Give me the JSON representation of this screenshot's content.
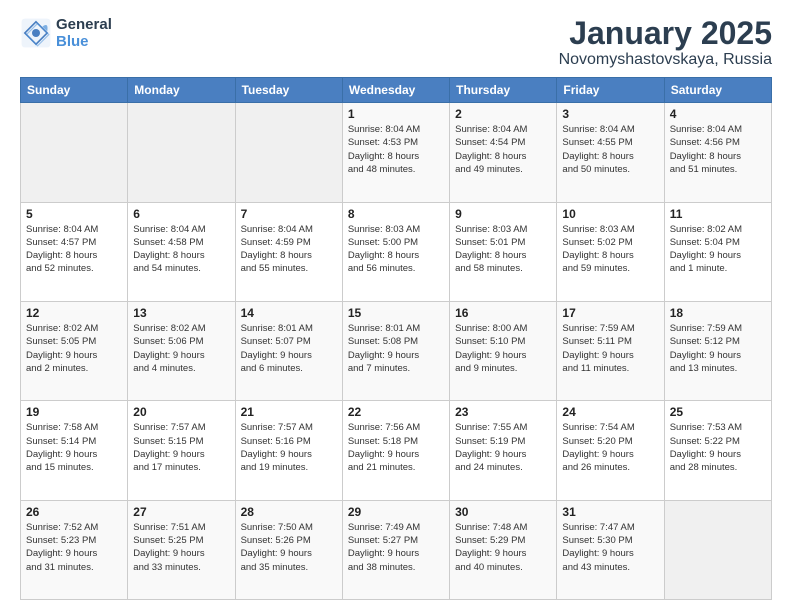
{
  "logo": {
    "line1": "General",
    "line2": "Blue"
  },
  "title": "January 2025",
  "subtitle": "Novomyshastovskaya, Russia",
  "weekdays": [
    "Sunday",
    "Monday",
    "Tuesday",
    "Wednesday",
    "Thursday",
    "Friday",
    "Saturday"
  ],
  "weeks": [
    [
      {
        "day": "",
        "info": ""
      },
      {
        "day": "",
        "info": ""
      },
      {
        "day": "",
        "info": ""
      },
      {
        "day": "1",
        "info": "Sunrise: 8:04 AM\nSunset: 4:53 PM\nDaylight: 8 hours\nand 48 minutes."
      },
      {
        "day": "2",
        "info": "Sunrise: 8:04 AM\nSunset: 4:54 PM\nDaylight: 8 hours\nand 49 minutes."
      },
      {
        "day": "3",
        "info": "Sunrise: 8:04 AM\nSunset: 4:55 PM\nDaylight: 8 hours\nand 50 minutes."
      },
      {
        "day": "4",
        "info": "Sunrise: 8:04 AM\nSunset: 4:56 PM\nDaylight: 8 hours\nand 51 minutes."
      }
    ],
    [
      {
        "day": "5",
        "info": "Sunrise: 8:04 AM\nSunset: 4:57 PM\nDaylight: 8 hours\nand 52 minutes."
      },
      {
        "day": "6",
        "info": "Sunrise: 8:04 AM\nSunset: 4:58 PM\nDaylight: 8 hours\nand 54 minutes."
      },
      {
        "day": "7",
        "info": "Sunrise: 8:04 AM\nSunset: 4:59 PM\nDaylight: 8 hours\nand 55 minutes."
      },
      {
        "day": "8",
        "info": "Sunrise: 8:03 AM\nSunset: 5:00 PM\nDaylight: 8 hours\nand 56 minutes."
      },
      {
        "day": "9",
        "info": "Sunrise: 8:03 AM\nSunset: 5:01 PM\nDaylight: 8 hours\nand 58 minutes."
      },
      {
        "day": "10",
        "info": "Sunrise: 8:03 AM\nSunset: 5:02 PM\nDaylight: 8 hours\nand 59 minutes."
      },
      {
        "day": "11",
        "info": "Sunrise: 8:02 AM\nSunset: 5:04 PM\nDaylight: 9 hours\nand 1 minute."
      }
    ],
    [
      {
        "day": "12",
        "info": "Sunrise: 8:02 AM\nSunset: 5:05 PM\nDaylight: 9 hours\nand 2 minutes."
      },
      {
        "day": "13",
        "info": "Sunrise: 8:02 AM\nSunset: 5:06 PM\nDaylight: 9 hours\nand 4 minutes."
      },
      {
        "day": "14",
        "info": "Sunrise: 8:01 AM\nSunset: 5:07 PM\nDaylight: 9 hours\nand 6 minutes."
      },
      {
        "day": "15",
        "info": "Sunrise: 8:01 AM\nSunset: 5:08 PM\nDaylight: 9 hours\nand 7 minutes."
      },
      {
        "day": "16",
        "info": "Sunrise: 8:00 AM\nSunset: 5:10 PM\nDaylight: 9 hours\nand 9 minutes."
      },
      {
        "day": "17",
        "info": "Sunrise: 7:59 AM\nSunset: 5:11 PM\nDaylight: 9 hours\nand 11 minutes."
      },
      {
        "day": "18",
        "info": "Sunrise: 7:59 AM\nSunset: 5:12 PM\nDaylight: 9 hours\nand 13 minutes."
      }
    ],
    [
      {
        "day": "19",
        "info": "Sunrise: 7:58 AM\nSunset: 5:14 PM\nDaylight: 9 hours\nand 15 minutes."
      },
      {
        "day": "20",
        "info": "Sunrise: 7:57 AM\nSunset: 5:15 PM\nDaylight: 9 hours\nand 17 minutes."
      },
      {
        "day": "21",
        "info": "Sunrise: 7:57 AM\nSunset: 5:16 PM\nDaylight: 9 hours\nand 19 minutes."
      },
      {
        "day": "22",
        "info": "Sunrise: 7:56 AM\nSunset: 5:18 PM\nDaylight: 9 hours\nand 21 minutes."
      },
      {
        "day": "23",
        "info": "Sunrise: 7:55 AM\nSunset: 5:19 PM\nDaylight: 9 hours\nand 24 minutes."
      },
      {
        "day": "24",
        "info": "Sunrise: 7:54 AM\nSunset: 5:20 PM\nDaylight: 9 hours\nand 26 minutes."
      },
      {
        "day": "25",
        "info": "Sunrise: 7:53 AM\nSunset: 5:22 PM\nDaylight: 9 hours\nand 28 minutes."
      }
    ],
    [
      {
        "day": "26",
        "info": "Sunrise: 7:52 AM\nSunset: 5:23 PM\nDaylight: 9 hours\nand 31 minutes."
      },
      {
        "day": "27",
        "info": "Sunrise: 7:51 AM\nSunset: 5:25 PM\nDaylight: 9 hours\nand 33 minutes."
      },
      {
        "day": "28",
        "info": "Sunrise: 7:50 AM\nSunset: 5:26 PM\nDaylight: 9 hours\nand 35 minutes."
      },
      {
        "day": "29",
        "info": "Sunrise: 7:49 AM\nSunset: 5:27 PM\nDaylight: 9 hours\nand 38 minutes."
      },
      {
        "day": "30",
        "info": "Sunrise: 7:48 AM\nSunset: 5:29 PM\nDaylight: 9 hours\nand 40 minutes."
      },
      {
        "day": "31",
        "info": "Sunrise: 7:47 AM\nSunset: 5:30 PM\nDaylight: 9 hours\nand 43 minutes."
      },
      {
        "day": "",
        "info": ""
      }
    ]
  ]
}
